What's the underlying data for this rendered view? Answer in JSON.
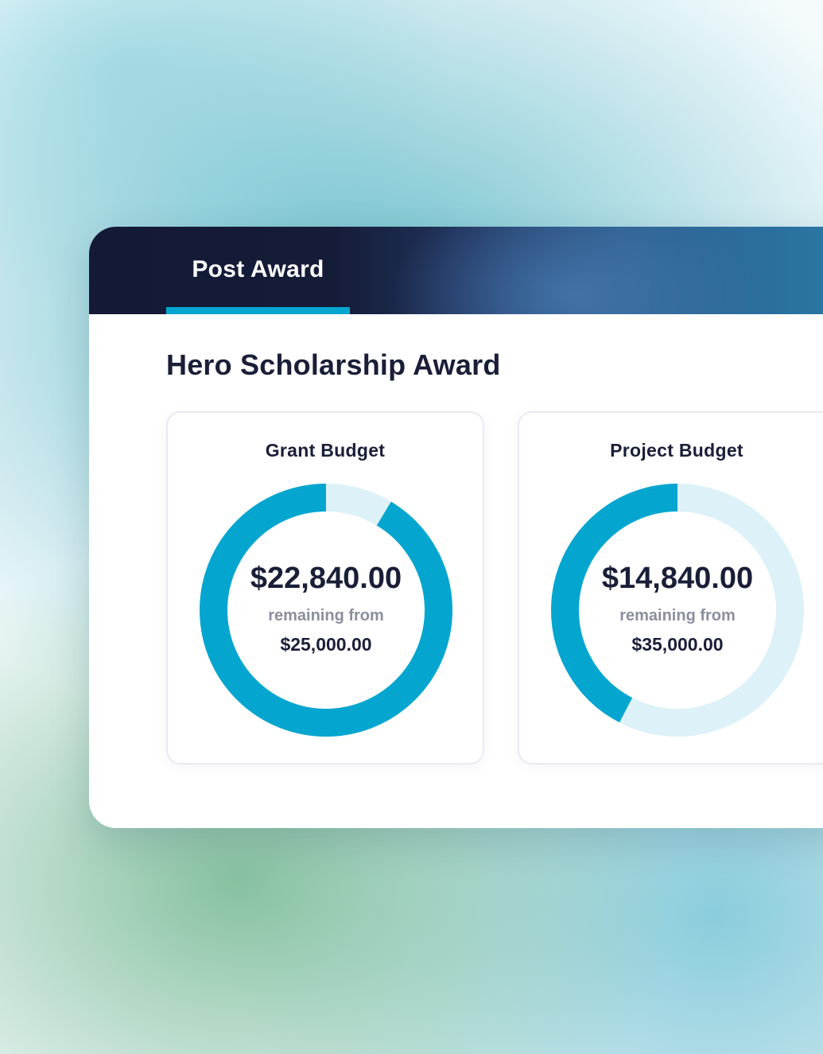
{
  "header": {
    "tab_label": "Post Award"
  },
  "award": {
    "title": "Hero Scholarship Award"
  },
  "colors": {
    "accent": "#04a6cf",
    "track": "#dcf1f8",
    "header_dark": "#141a36",
    "text_dark": "#1a1f38"
  },
  "cards": [
    {
      "title": "Grant Budget",
      "remaining": "$22,840.00",
      "remaining_label": "remaining from",
      "total": "$25,000.00",
      "remaining_fraction": 0.9136
    },
    {
      "title": "Project Budget",
      "remaining": "$14,840.00",
      "remaining_label": "remaining from",
      "total": "$35,000.00",
      "remaining_fraction": 0.424
    }
  ]
}
